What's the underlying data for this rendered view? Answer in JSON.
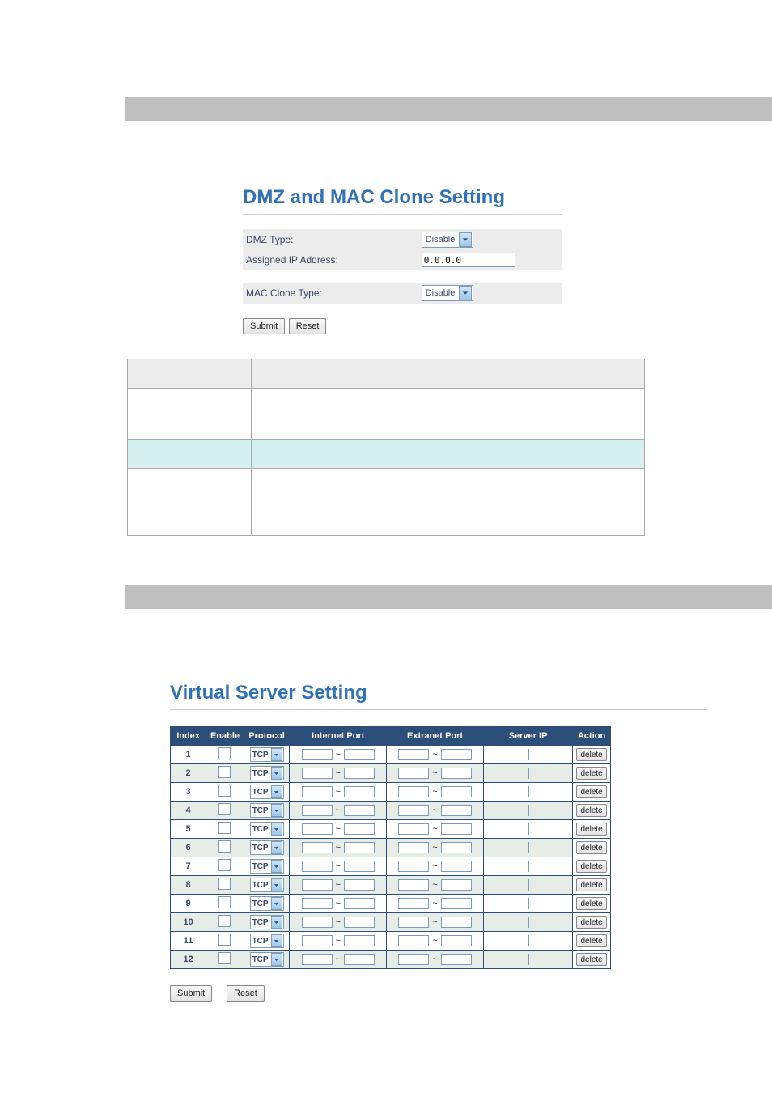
{
  "dmz": {
    "title": "DMZ and MAC Clone Setting",
    "row1_label": "DMZ Type:",
    "row1_value": "Disable",
    "row2_label": "Assigned IP Address:",
    "row2_value": "0.0.0.0",
    "row3_label": "MAC Clone Type:",
    "row3_value": "Disable",
    "submit": "Submit",
    "reset": "Reset"
  },
  "vs": {
    "title": "Virtual Server Setting",
    "headers": {
      "index": "Index",
      "enable": "Enable",
      "protocol": "Protocol",
      "internet_port": "Internet Port",
      "extranet_port": "Extranet Port",
      "server_ip": "Server IP",
      "action": "Action"
    },
    "proto_value": "TCP",
    "delete_label": "delete",
    "tilde": "~",
    "rows": [
      {
        "idx": "1"
      },
      {
        "idx": "2"
      },
      {
        "idx": "3"
      },
      {
        "idx": "4"
      },
      {
        "idx": "5"
      },
      {
        "idx": "6"
      },
      {
        "idx": "7"
      },
      {
        "idx": "8"
      },
      {
        "idx": "9"
      },
      {
        "idx": "10"
      },
      {
        "idx": "11"
      },
      {
        "idx": "12"
      }
    ],
    "submit": "Submit",
    "reset": "Reset"
  }
}
